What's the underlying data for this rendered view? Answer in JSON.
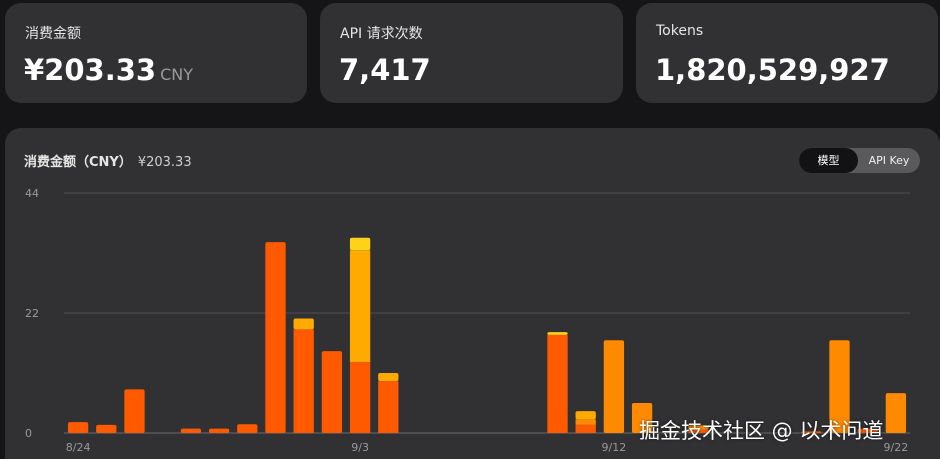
{
  "stats": [
    {
      "label": "消费金额",
      "value": "¥203.33",
      "unit": "CNY"
    },
    {
      "label": "API 请求次数",
      "value": "7,417",
      "unit": ""
    },
    {
      "label": "Tokens",
      "value": "1,820,529,927",
      "unit": ""
    }
  ],
  "chart": {
    "title": "消费金额（CNY）",
    "total": "¥203.33",
    "toggle": {
      "model_label": "模型",
      "apikey_label": "API Key",
      "active": "模型"
    }
  },
  "chart_data": {
    "type": "bar",
    "stacked": true,
    "ylim": [
      0,
      44
    ],
    "yticks": [
      "0",
      "22",
      "44"
    ],
    "grid": true,
    "x_tick_labels": [
      {
        "label": "8/24",
        "index": 0
      },
      {
        "label": "9/3",
        "index": 10
      },
      {
        "label": "9/12",
        "index": 19
      },
      {
        "label": "9/22",
        "index": 29
      }
    ],
    "categories": [
      "8/24",
      "8/25",
      "8/26",
      "8/27",
      "8/28",
      "8/29",
      "8/30",
      "8/31",
      "9/1",
      "9/2",
      "9/3",
      "9/4",
      "9/5",
      "9/6",
      "9/7",
      "9/8",
      "9/9",
      "9/10",
      "9/11",
      "9/12",
      "9/13",
      "9/14",
      "9/15",
      "9/16",
      "9/17",
      "9/18",
      "9/19",
      "9/20",
      "9/21",
      "9/22"
    ],
    "series": [
      {
        "color": "#ff5a00",
        "values": [
          2,
          1.5,
          8,
          0,
          0.8,
          0.8,
          1.6,
          35,
          19,
          15,
          13,
          9.5,
          0,
          0,
          0,
          0,
          0,
          18,
          1.5,
          0,
          0,
          0,
          0.6,
          0,
          0,
          0,
          0.3,
          0,
          0.8,
          0
        ]
      },
      {
        "color": "#ff8a00",
        "values": [
          0,
          0,
          0,
          0,
          0,
          0,
          0,
          0,
          0,
          0,
          0,
          0,
          0,
          0,
          0,
          0,
          0,
          0,
          1,
          17,
          5.5,
          0,
          0.8,
          0,
          0,
          0,
          0,
          17,
          0,
          7.3
        ]
      },
      {
        "color": "#ffaa00",
        "values": [
          0,
          0,
          0,
          0,
          0,
          0,
          0,
          0,
          2,
          0,
          20.5,
          1.5,
          0,
          0,
          0,
          0,
          0,
          0,
          1.5,
          0,
          0,
          0,
          0,
          0,
          0,
          0,
          0,
          0,
          0,
          0
        ]
      },
      {
        "color": "#ffd21a",
        "values": [
          0,
          0,
          0,
          0,
          0,
          0,
          0,
          0,
          0,
          0,
          2.3,
          0,
          0,
          0,
          0,
          0,
          0,
          0.5,
          0,
          0,
          0,
          0,
          0,
          0,
          0,
          0,
          0,
          0,
          0,
          0
        ]
      }
    ]
  },
  "watermark": "掘金技术社区 @ 以术问道"
}
